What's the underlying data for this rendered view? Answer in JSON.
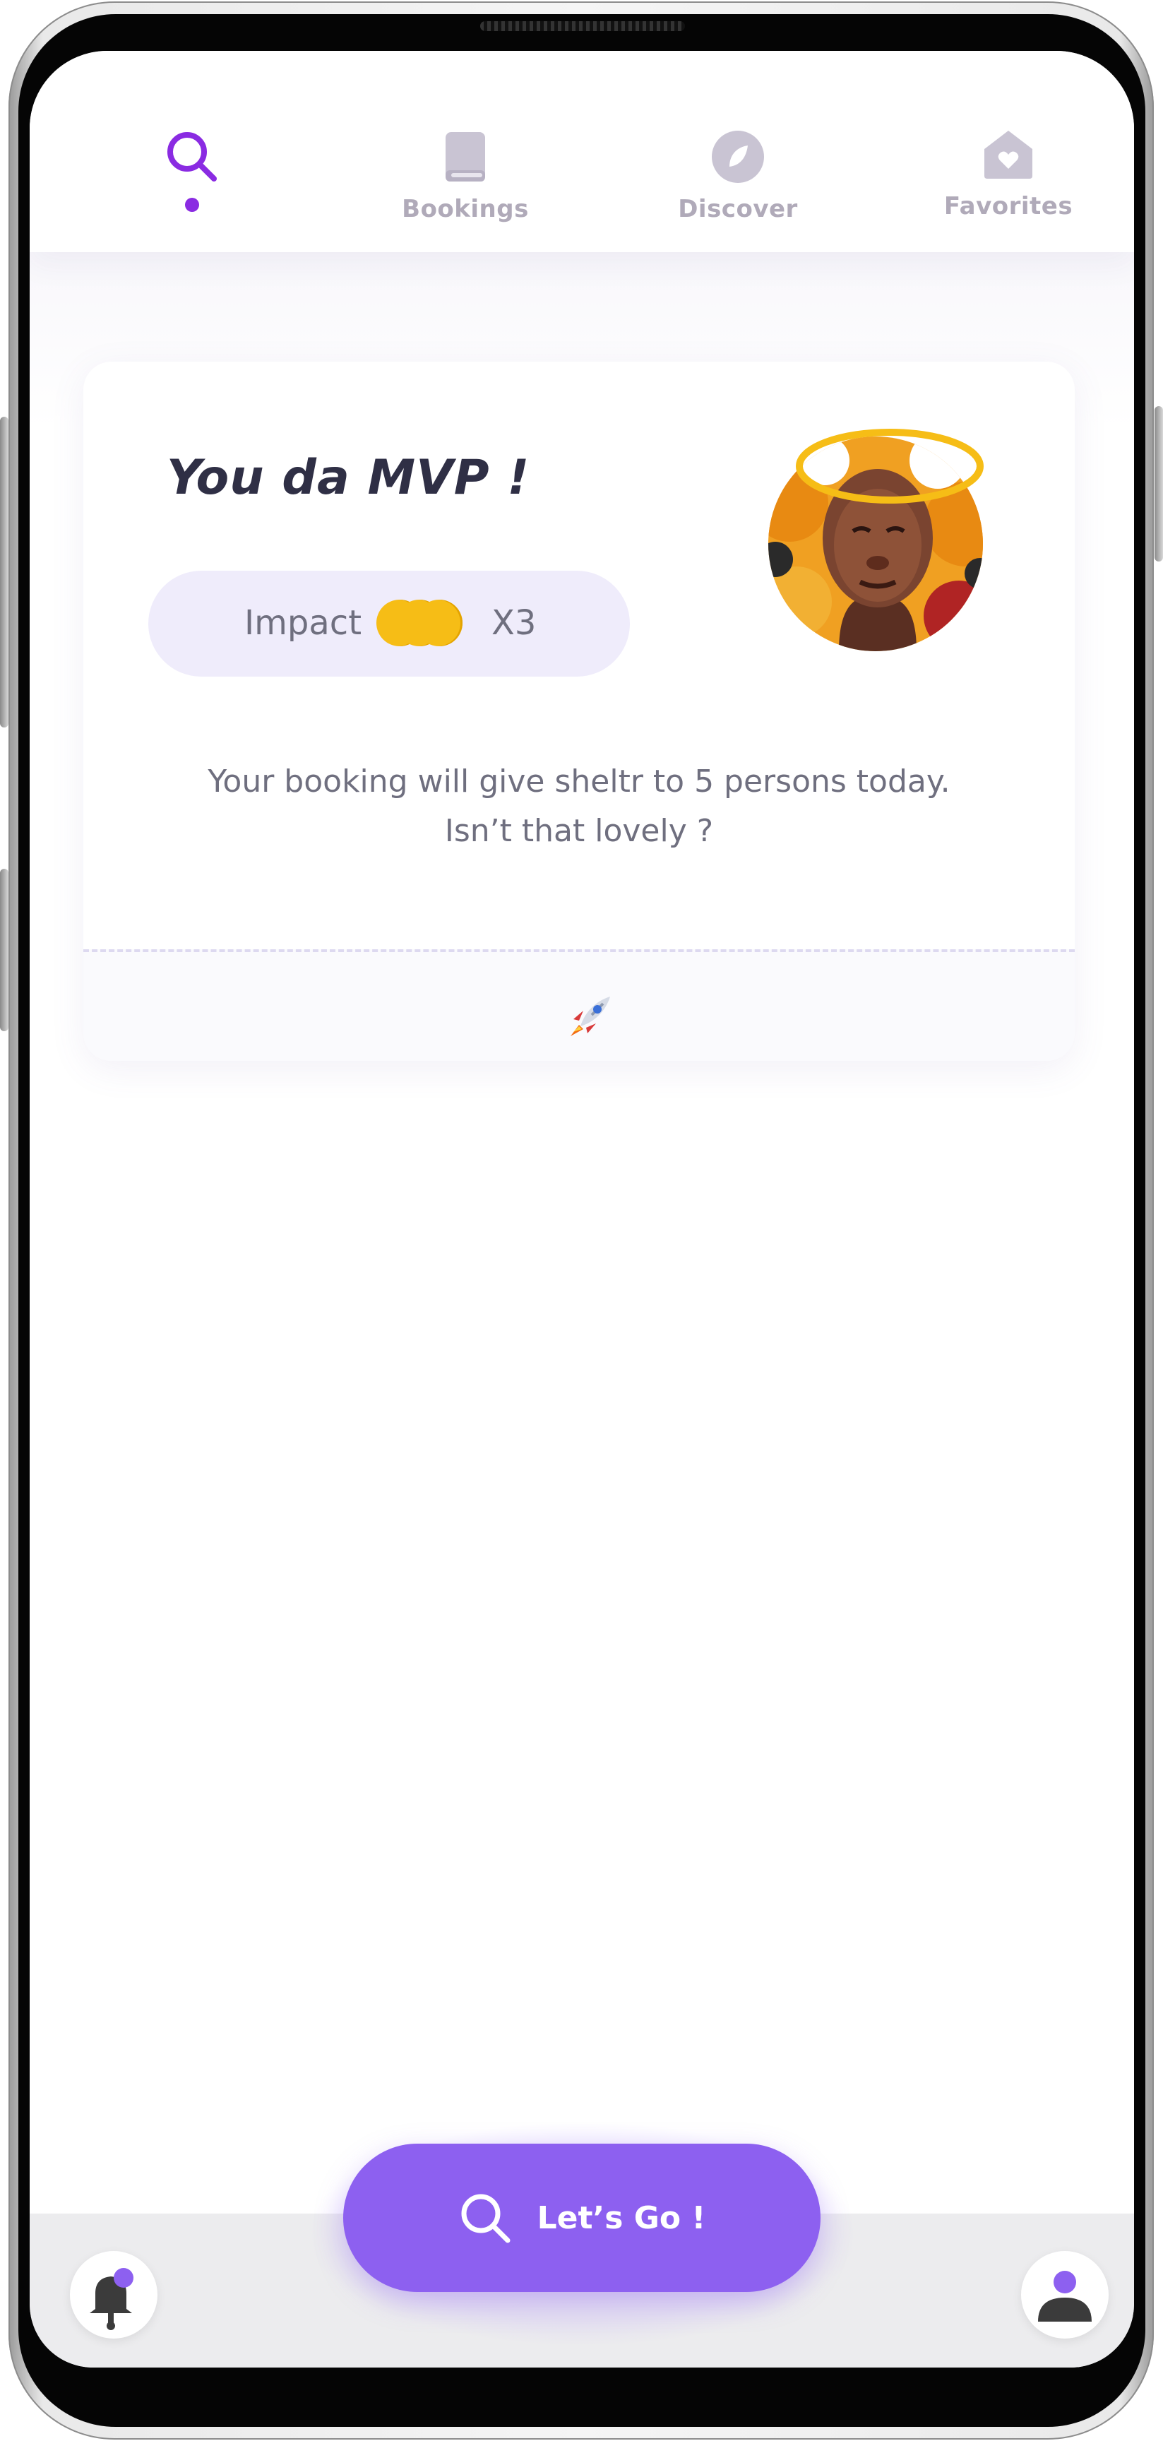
{
  "nav": {
    "items": [
      {
        "id": "search",
        "label": "",
        "active": true,
        "icon": "search-icon"
      },
      {
        "id": "bookings",
        "label": "Bookings",
        "active": false,
        "icon": "book-icon"
      },
      {
        "id": "discover",
        "label": "Discover",
        "active": false,
        "icon": "compass-leaf-icon"
      },
      {
        "id": "favorites",
        "label": "Favorites",
        "active": false,
        "icon": "house-heart-icon"
      }
    ]
  },
  "card": {
    "title": "You da MVP !",
    "impact_label": "Impact",
    "impact_multiplier": "X3",
    "coins_count": 3,
    "message_line1": "Your booking will give sheltr to 5 persons today.",
    "message_line2": "Isn’t that lovely ?",
    "footer_emoji": "🚀",
    "avatar": "haloed-portrait-avatar"
  },
  "cta": {
    "label": "Let’s Go !",
    "icon": "search-icon"
  },
  "bottom": {
    "left_icon": "bell-icon",
    "right_icon": "user-icon"
  },
  "colors": {
    "accent": "#8d60f0",
    "active_nav": "#8a2be2",
    "inactive_nav": "#b0aab9",
    "coin": "#f6bd16",
    "pill_bg": "#efecfb",
    "text_dark": "#2f2f45",
    "text_muted": "#6f6f7f"
  }
}
